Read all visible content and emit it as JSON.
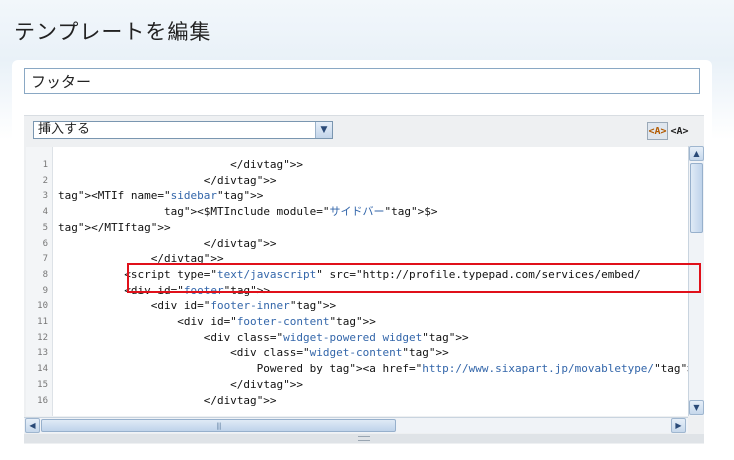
{
  "page": {
    "title": "テンプレートを編集"
  },
  "template_name": {
    "value": "フッター"
  },
  "toolbar": {
    "insert_select_label": "挿入する",
    "highlight_on_label": "<A>",
    "highlight_off_label": "<A>"
  },
  "code_lines": [
    {
      "num": "1",
      "text": "                          </div>"
    },
    {
      "num": "2",
      "text": "                      </div>"
    },
    {
      "num": "3",
      "text": "<MTIf name=\"sidebar\">"
    },
    {
      "num": "4",
      "text": "                <$MTInclude module=\"サイドバー\"$>"
    },
    {
      "num": "5",
      "text": "</MTIf>"
    },
    {
      "num": "6",
      "text": "                      </div>"
    },
    {
      "num": "7",
      "text": "              </div>"
    },
    {
      "num": "8",
      "text": "          <script type=\"text/javascript\" src=\"http://profile.typepad.com/services/embed/"
    },
    {
      "num": "9",
      "text": "          <div id=\"footer\">"
    },
    {
      "num": "10",
      "text": "              <div id=\"footer-inner\">"
    },
    {
      "num": "11",
      "text": "                  <div id=\"footer-content\">"
    },
    {
      "num": "12",
      "text": "                      <div class=\"widget-powered widget\">"
    },
    {
      "num": "13",
      "text": "                          <div class=\"widget-content\">"
    },
    {
      "num": "14",
      "text": "                              Powered by <a href=\"http://www.sixapart.jp/movabletype/\">("
    },
    {
      "num": "15",
      "text": "                          </div>"
    },
    {
      "num": "16",
      "text": "                      </div>"
    }
  ],
  "colors": {
    "tag": "#b25a00",
    "string": "#3366aa",
    "highlight": "#e0101a"
  },
  "icons": {
    "select_arrow": "chevron-down-icon",
    "scroll_up": "arrow-up-icon",
    "scroll_down": "arrow-down-icon",
    "scroll_left": "arrow-left-icon",
    "scroll_right": "arrow-right-icon"
  }
}
